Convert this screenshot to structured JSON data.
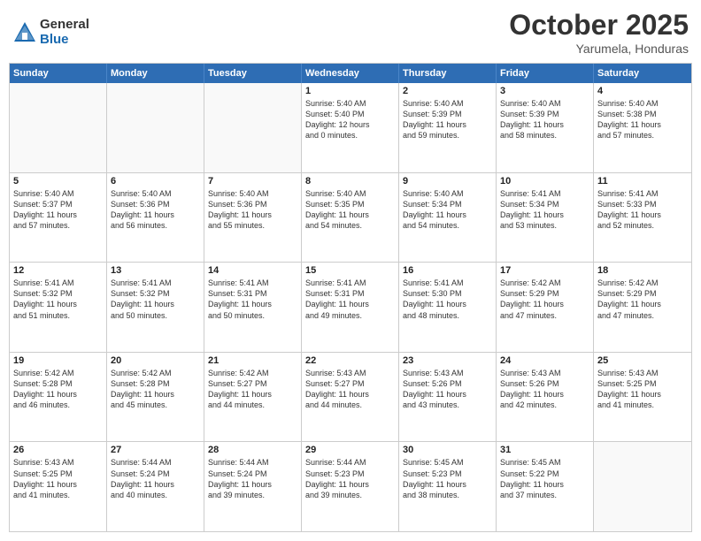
{
  "logo": {
    "general": "General",
    "blue": "Blue"
  },
  "title": "October 2025",
  "subtitle": "Yarumela, Honduras",
  "days": [
    "Sunday",
    "Monday",
    "Tuesday",
    "Wednesday",
    "Thursday",
    "Friday",
    "Saturday"
  ],
  "rows": [
    [
      {
        "day": "",
        "content": ""
      },
      {
        "day": "",
        "content": ""
      },
      {
        "day": "",
        "content": ""
      },
      {
        "day": "1",
        "content": "Sunrise: 5:40 AM\nSunset: 5:40 PM\nDaylight: 12 hours\nand 0 minutes."
      },
      {
        "day": "2",
        "content": "Sunrise: 5:40 AM\nSunset: 5:39 PM\nDaylight: 11 hours\nand 59 minutes."
      },
      {
        "day": "3",
        "content": "Sunrise: 5:40 AM\nSunset: 5:39 PM\nDaylight: 11 hours\nand 58 minutes."
      },
      {
        "day": "4",
        "content": "Sunrise: 5:40 AM\nSunset: 5:38 PM\nDaylight: 11 hours\nand 57 minutes."
      }
    ],
    [
      {
        "day": "5",
        "content": "Sunrise: 5:40 AM\nSunset: 5:37 PM\nDaylight: 11 hours\nand 57 minutes."
      },
      {
        "day": "6",
        "content": "Sunrise: 5:40 AM\nSunset: 5:36 PM\nDaylight: 11 hours\nand 56 minutes."
      },
      {
        "day": "7",
        "content": "Sunrise: 5:40 AM\nSunset: 5:36 PM\nDaylight: 11 hours\nand 55 minutes."
      },
      {
        "day": "8",
        "content": "Sunrise: 5:40 AM\nSunset: 5:35 PM\nDaylight: 11 hours\nand 54 minutes."
      },
      {
        "day": "9",
        "content": "Sunrise: 5:40 AM\nSunset: 5:34 PM\nDaylight: 11 hours\nand 54 minutes."
      },
      {
        "day": "10",
        "content": "Sunrise: 5:41 AM\nSunset: 5:34 PM\nDaylight: 11 hours\nand 53 minutes."
      },
      {
        "day": "11",
        "content": "Sunrise: 5:41 AM\nSunset: 5:33 PM\nDaylight: 11 hours\nand 52 minutes."
      }
    ],
    [
      {
        "day": "12",
        "content": "Sunrise: 5:41 AM\nSunset: 5:32 PM\nDaylight: 11 hours\nand 51 minutes."
      },
      {
        "day": "13",
        "content": "Sunrise: 5:41 AM\nSunset: 5:32 PM\nDaylight: 11 hours\nand 50 minutes."
      },
      {
        "day": "14",
        "content": "Sunrise: 5:41 AM\nSunset: 5:31 PM\nDaylight: 11 hours\nand 50 minutes."
      },
      {
        "day": "15",
        "content": "Sunrise: 5:41 AM\nSunset: 5:31 PM\nDaylight: 11 hours\nand 49 minutes."
      },
      {
        "day": "16",
        "content": "Sunrise: 5:41 AM\nSunset: 5:30 PM\nDaylight: 11 hours\nand 48 minutes."
      },
      {
        "day": "17",
        "content": "Sunrise: 5:42 AM\nSunset: 5:29 PM\nDaylight: 11 hours\nand 47 minutes."
      },
      {
        "day": "18",
        "content": "Sunrise: 5:42 AM\nSunset: 5:29 PM\nDaylight: 11 hours\nand 47 minutes."
      }
    ],
    [
      {
        "day": "19",
        "content": "Sunrise: 5:42 AM\nSunset: 5:28 PM\nDaylight: 11 hours\nand 46 minutes."
      },
      {
        "day": "20",
        "content": "Sunrise: 5:42 AM\nSunset: 5:28 PM\nDaylight: 11 hours\nand 45 minutes."
      },
      {
        "day": "21",
        "content": "Sunrise: 5:42 AM\nSunset: 5:27 PM\nDaylight: 11 hours\nand 44 minutes."
      },
      {
        "day": "22",
        "content": "Sunrise: 5:43 AM\nSunset: 5:27 PM\nDaylight: 11 hours\nand 44 minutes."
      },
      {
        "day": "23",
        "content": "Sunrise: 5:43 AM\nSunset: 5:26 PM\nDaylight: 11 hours\nand 43 minutes."
      },
      {
        "day": "24",
        "content": "Sunrise: 5:43 AM\nSunset: 5:26 PM\nDaylight: 11 hours\nand 42 minutes."
      },
      {
        "day": "25",
        "content": "Sunrise: 5:43 AM\nSunset: 5:25 PM\nDaylight: 11 hours\nand 41 minutes."
      }
    ],
    [
      {
        "day": "26",
        "content": "Sunrise: 5:43 AM\nSunset: 5:25 PM\nDaylight: 11 hours\nand 41 minutes."
      },
      {
        "day": "27",
        "content": "Sunrise: 5:44 AM\nSunset: 5:24 PM\nDaylight: 11 hours\nand 40 minutes."
      },
      {
        "day": "28",
        "content": "Sunrise: 5:44 AM\nSunset: 5:24 PM\nDaylight: 11 hours\nand 39 minutes."
      },
      {
        "day": "29",
        "content": "Sunrise: 5:44 AM\nSunset: 5:23 PM\nDaylight: 11 hours\nand 39 minutes."
      },
      {
        "day": "30",
        "content": "Sunrise: 5:45 AM\nSunset: 5:23 PM\nDaylight: 11 hours\nand 38 minutes."
      },
      {
        "day": "31",
        "content": "Sunrise: 5:45 AM\nSunset: 5:22 PM\nDaylight: 11 hours\nand 37 minutes."
      },
      {
        "day": "",
        "content": ""
      }
    ]
  ]
}
